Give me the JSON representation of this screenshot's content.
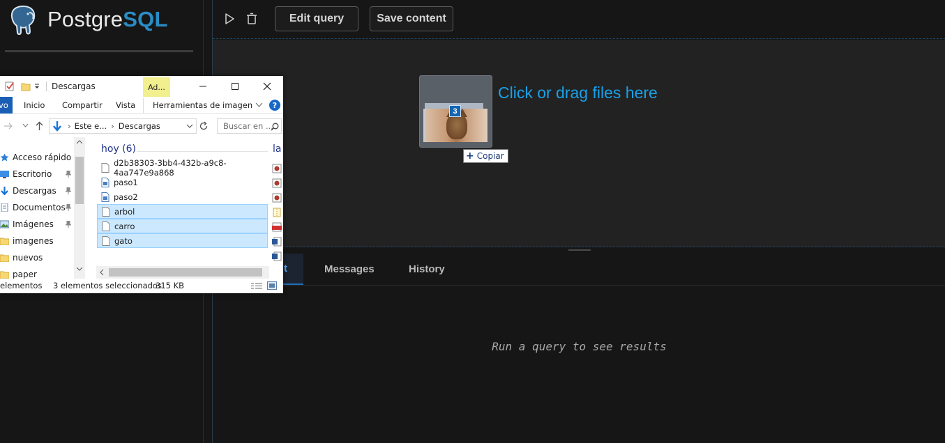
{
  "app": {
    "logo_text": "Postgre",
    "logo_text_accent": "SQL",
    "logo_icon": "elephant-icon",
    "accent_color": "#1aa0e8"
  },
  "toolbar": {
    "run_icon": "play-icon",
    "delete_icon": "trash-icon",
    "edit_query_label": "Edit query",
    "save_content_label": "Save content"
  },
  "dropzone": {
    "prompt": "Click or drag files here",
    "drag_count": "3",
    "drag_effect_label": "Copiar"
  },
  "results": {
    "tabs": [
      {
        "label": "t",
        "active": true
      },
      {
        "label": "Messages",
        "active": false
      },
      {
        "label": "History",
        "active": false
      }
    ],
    "empty_message": "Run a query to see results"
  },
  "explorer": {
    "title": "Descargas",
    "contextual_tab": "Ad...",
    "ribbon_tabs": [
      "vo",
      "Inicio",
      "Compartir",
      "Vista",
      "Herramientas de imagen"
    ],
    "address_parts": [
      "Este e...",
      "Descargas"
    ],
    "search_placeholder": "Buscar en ...",
    "nav_items": [
      {
        "label": "Acceso rápido",
        "icon": "star-icon",
        "pinned": false
      },
      {
        "label": "Escritorio",
        "icon": "desktop-icon",
        "pinned": true
      },
      {
        "label": "Descargas",
        "icon": "download-icon",
        "pinned": true
      },
      {
        "label": "Documentos",
        "icon": "documents-icon",
        "pinned": true
      },
      {
        "label": "Imágenes",
        "icon": "pictures-icon",
        "pinned": true
      },
      {
        "label": "imagenes",
        "icon": "folder-icon",
        "pinned": false
      },
      {
        "label": "nuevos",
        "icon": "folder-icon",
        "pinned": false
      },
      {
        "label": "paper",
        "icon": "folder-icon",
        "pinned": false
      }
    ],
    "group_header": "hoy (6)",
    "group_header_right": "la",
    "files": [
      {
        "name": "d2b38303-3bb4-432b-a9c8-4aa747e9a868",
        "selected": false
      },
      {
        "name": "paso1",
        "selected": false
      },
      {
        "name": "paso2",
        "selected": false
      },
      {
        "name": "arbol",
        "selected": true
      },
      {
        "name": "carro",
        "selected": true
      },
      {
        "name": "gato",
        "selected": true
      }
    ],
    "status_left": "elementos",
    "status_selection": "3 elementos seleccionados",
    "status_size": "315 KB"
  }
}
